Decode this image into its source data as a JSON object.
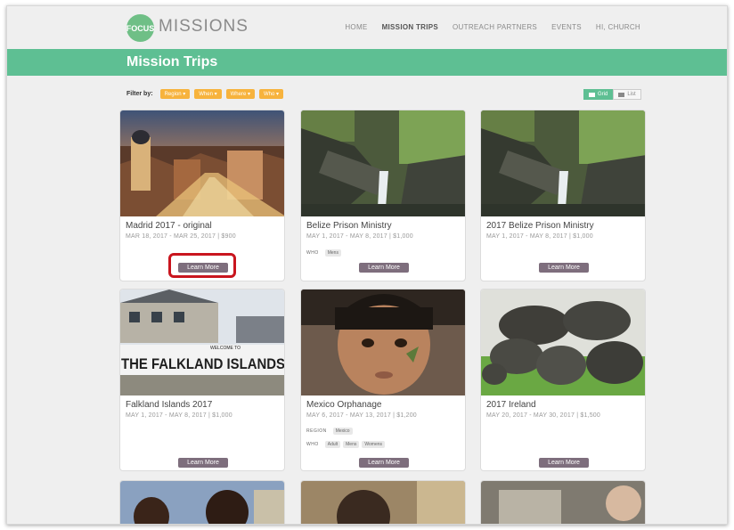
{
  "nav": {
    "logo_mark": "FOCUS",
    "logo_text": "MISSIONS",
    "links": [
      "HOME",
      "MISSION TRIPS",
      "OUTREACH PARTNERS",
      "EVENTS",
      "HI, CHURCH"
    ]
  },
  "banner": {
    "title": "Mission Trips"
  },
  "filter": {
    "label": "Filter by:",
    "buttons": [
      "Region ▾",
      "When ▾",
      "Where ▾",
      "Who ▾"
    ]
  },
  "view_toggle": {
    "grid": "Grid",
    "list": "List"
  },
  "cards": [
    {
      "title": "Madrid 2017 - original",
      "meta": "MAR 18, 2017 - MAR 25, 2017 | $900",
      "button": "Learn More"
    },
    {
      "title": "Belize Prison Ministry",
      "meta": "MAY 1, 2017 - MAY 8, 2017 | $1,000",
      "who_label": "WHO",
      "who_tags": [
        "Mens"
      ],
      "button": "Learn More"
    },
    {
      "title": "2017 Belize Prison Ministry",
      "meta": "MAY 1, 2017 - MAY 8, 2017 | $1,000",
      "button": "Learn More"
    },
    {
      "title": "Falkland Islands 2017",
      "meta": "MAY 1, 2017 - MAY 8, 2017 | $1,000",
      "image_text_1": "WELCOME TO",
      "image_text_2": "THE FALKLAND ISLANDS",
      "button": "Learn More"
    },
    {
      "title": "Mexico Orphanage",
      "meta": "MAY 6, 2017 - MAY 13, 2017 | $1,200",
      "region_label": "REGION",
      "region_tags": [
        "Mexico"
      ],
      "who_label": "WHO",
      "who_tags": [
        "Adult",
        "Mens",
        "Womens"
      ],
      "button": "Learn More"
    },
    {
      "title": "2017 Ireland",
      "meta": "MAY 20, 2017 - MAY 30, 2017 | $1,500",
      "button": "Learn More"
    }
  ],
  "colors": {
    "accent_green": "#5ebf93",
    "filter_orange": "#f7b33d",
    "button_mauve": "#7e6e7d",
    "highlight_red": "#c9151e"
  }
}
